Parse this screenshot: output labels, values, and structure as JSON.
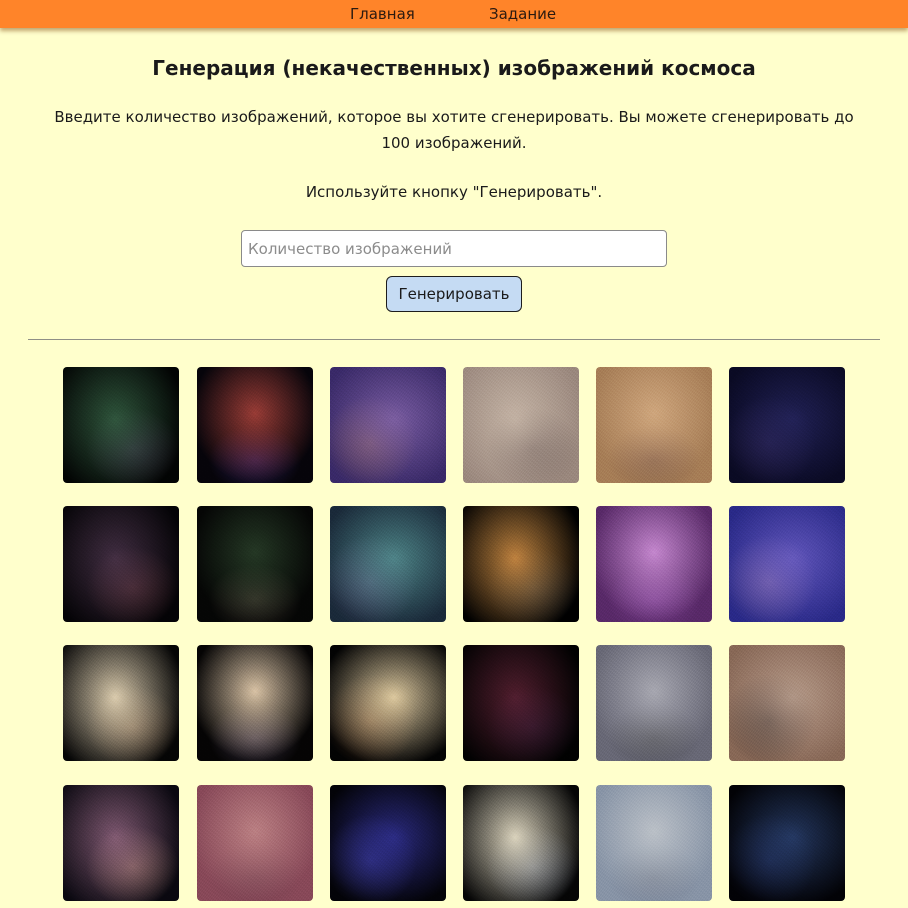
{
  "nav": {
    "home_label": "Главная",
    "task_label": "Задание"
  },
  "page": {
    "title": "Генерация (некачественных) изображений космоса",
    "description": "Введите количество изображений, которое вы хотите сгенерировать. Вы можете сгенерировать до 100 изображений.",
    "hint": "Используйте кнопку \"Генерировать\"."
  },
  "form": {
    "count_placeholder": "Количество изображений",
    "count_value": "",
    "generate_label": "Генерировать"
  },
  "gallery": {
    "images": [
      {
        "bg": "#020403",
        "blobs": [
          {
            "color": "#3a6a4a",
            "op": 0.8
          },
          {
            "color": "#5a3a6a",
            "op": 0.5
          }
        ]
      },
      {
        "bg": "#06040a",
        "blobs": [
          {
            "color": "#b4463e",
            "op": 0.85
          },
          {
            "color": "#3b2a7a",
            "op": 0.6
          }
        ]
      },
      {
        "bg": "#3a2a6a",
        "blobs": [
          {
            "color": "#8a6ab0",
            "op": 0.8
          },
          {
            "color": "#b07a5a",
            "op": 0.5
          }
        ]
      },
      {
        "bg": "#9c8a80",
        "blobs": [
          {
            "color": "#d6c6b6",
            "op": 0.7
          },
          {
            "color": "#5a4a4a",
            "op": 0.6
          }
        ]
      },
      {
        "bg": "#a88058",
        "blobs": [
          {
            "color": "#e0b890",
            "op": 0.7
          },
          {
            "color": "#6a4a40",
            "op": 0.5
          }
        ]
      },
      {
        "bg": "#0a0a24",
        "blobs": [
          {
            "color": "#2a2a6a",
            "op": 0.7
          },
          {
            "color": "#4a3a7a",
            "op": 0.4
          }
        ]
      },
      {
        "bg": "#040306",
        "blobs": [
          {
            "color": "#6a4a6a",
            "op": 0.6
          },
          {
            "color": "#8a4a4a",
            "op": 0.4
          }
        ]
      },
      {
        "bg": "#050605",
        "blobs": [
          {
            "color": "#3a5a3a",
            "op": 0.6
          },
          {
            "color": "#7a6a5a",
            "op": 0.4
          }
        ]
      },
      {
        "bg": "#1a2a3a",
        "blobs": [
          {
            "color": "#5a9a9a",
            "op": 0.8
          },
          {
            "color": "#7a6a9a",
            "op": 0.5
          }
        ]
      },
      {
        "bg": "#000000",
        "blobs": [
          {
            "color": "#e09a4a",
            "op": 0.85
          },
          {
            "color": "#4a6a8a",
            "op": 0.3
          }
        ]
      },
      {
        "bg": "#5a2a6a",
        "blobs": [
          {
            "color": "#d89ae0",
            "op": 0.85
          },
          {
            "color": "#8a4aa0",
            "op": 0.6
          }
        ]
      },
      {
        "bg": "#2a2a8a",
        "blobs": [
          {
            "color": "#7a6ad0",
            "op": 0.7
          },
          {
            "color": "#b08ab0",
            "op": 0.5
          }
        ]
      },
      {
        "bg": "#050505",
        "blobs": [
          {
            "color": "#f0e0c0",
            "op": 0.9
          },
          {
            "color": "#a07a5a",
            "op": 0.5
          }
        ]
      },
      {
        "bg": "#050404",
        "blobs": [
          {
            "color": "#f0d8b8",
            "op": 0.9
          },
          {
            "color": "#6a5a7a",
            "op": 0.5
          }
        ]
      },
      {
        "bg": "#030303",
        "blobs": [
          {
            "color": "#f2ddb0",
            "op": 0.9
          },
          {
            "color": "#a06a40",
            "op": 0.5
          }
        ]
      },
      {
        "bg": "#010101",
        "blobs": [
          {
            "color": "#a03a5a",
            "op": 0.5
          },
          {
            "color": "#3a2a5a",
            "op": 0.3
          }
        ]
      },
      {
        "bg": "#6a6a78",
        "blobs": [
          {
            "color": "#b8b8c0",
            "op": 0.8
          },
          {
            "color": "#3a3a3a",
            "op": 0.5
          }
        ]
      },
      {
        "bg": "#8a6a58",
        "blobs": [
          {
            "color": "#c8b0a0",
            "op": 0.7
          },
          {
            "color": "#2a2020",
            "op": 0.6
          }
        ]
      },
      {
        "bg": "#0a0810",
        "blobs": [
          {
            "color": "#b07a9a",
            "op": 0.7
          },
          {
            "color": "#d0a080",
            "op": 0.5
          }
        ]
      },
      {
        "bg": "#8a4a5a",
        "blobs": [
          {
            "color": "#c89090",
            "op": 0.8
          },
          {
            "color": "#6a3a4a",
            "op": 0.5
          }
        ]
      },
      {
        "bg": "#030308",
        "blobs": [
          {
            "color": "#3a3ab0",
            "op": 0.7
          },
          {
            "color": "#4a4ac0",
            "op": 0.5
          }
        ]
      },
      {
        "bg": "#050505",
        "blobs": [
          {
            "color": "#f0e8d0",
            "op": 0.9
          },
          {
            "color": "#7a8ab0",
            "op": 0.5
          }
        ]
      },
      {
        "bg": "#8a96a8",
        "blobs": [
          {
            "color": "#c8ccd0",
            "op": 0.8
          },
          {
            "color": "#6a7080",
            "op": 0.5
          }
        ]
      },
      {
        "bg": "#020206",
        "blobs": [
          {
            "color": "#3a5a9a",
            "op": 0.6
          },
          {
            "color": "#2a3a7a",
            "op": 0.4
          }
        ]
      }
    ]
  }
}
